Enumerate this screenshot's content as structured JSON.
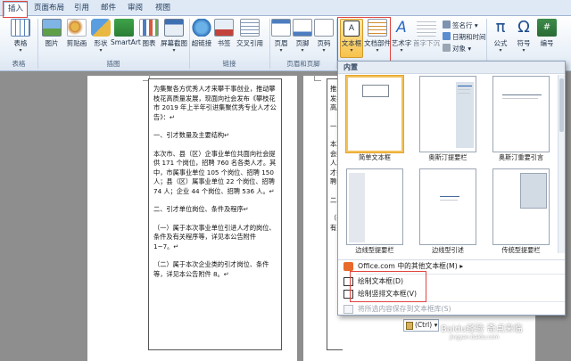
{
  "tabs": [
    "插入",
    "页面布局",
    "引用",
    "邮件",
    "审阅",
    "视图"
  ],
  "ribbon": {
    "groups": {
      "tables": "表格",
      "illustrations": "插图",
      "links": "链接",
      "header_footer": "页眉和页脚"
    },
    "buttons": {
      "table": "表格",
      "picture": "图片",
      "clipart": "剪贴画",
      "shapes": "形状",
      "smartart": "SmartArt",
      "chart": "图表",
      "screenshot": "屏幕截图",
      "hyperlink": "超链接",
      "bookmark": "书签",
      "crossref": "交叉引用",
      "header": "页眉",
      "footer": "页脚",
      "pagenum": "页码",
      "textbox": "文本框",
      "docparts": "文档部件",
      "wordart": "艺术字",
      "dropcap": "首字下沉",
      "signature": "签名行",
      "datetime": "日期和时间",
      "object": "对象",
      "equation": "公式",
      "symbol": "符号",
      "number": "编号"
    },
    "colors": {
      "accent_red": "#e0443e",
      "ribbon_blue": "#dfe9f5"
    }
  },
  "document": {
    "frame_paragraphs": [
      "为集聚各方优秀人才来攀干事创业，推动攀枝花高质量发展，现面向社会发布《攀枝花市 2019 年上半年引进集聚优秀专业人才公告》：↵",
      "一、引才数量及主要结构↵",
      "本次市、县（区）企事业单位共面向社会提供 171 个岗位，招聘 760 名各类人才。其中，市属事业单位 105 个岗位、招聘 150 人；县（区）属事业单位 22 个岗位、招聘 74 人；企业 44 个岗位、招聘 536 人。↵",
      "二、引才单位岗位、条件及程序↵",
      "（一）属于本次事业单位引进人才的岗位、条件及有关程序等，详见本公告附件 1~7。↵",
      "（二）属于本次企业类的引才岗位、条件等，详见本公告附件 8。↵"
    ],
    "frame2_snippets": [
      "推动",
      "发布",
      "高质",
      "一、",
      "本次",
      "会提",
      "人才",
      "才招",
      "聘 7",
      "二、",
      "（一",
      "有关"
    ]
  },
  "gallery": {
    "header": "内置",
    "items": [
      "简单文本框",
      "奥斯汀提要栏",
      "奥斯汀重要引言",
      "边线型提要栏",
      "边线型引述",
      "传统型提要栏"
    ],
    "menu": {
      "more": "Office.com 中的其他文本框(M)",
      "draw": "绘制文本框(D)",
      "draw_vertical": "绘制竖排文本框(V)",
      "save_selection": "将所选内容保存到文本框库(S)"
    }
  },
  "paste_tag": "(Ctrl) ▾",
  "watermark": {
    "text": "Baidu经验 奇点来临",
    "sub": "jingyan.baidu.com"
  }
}
